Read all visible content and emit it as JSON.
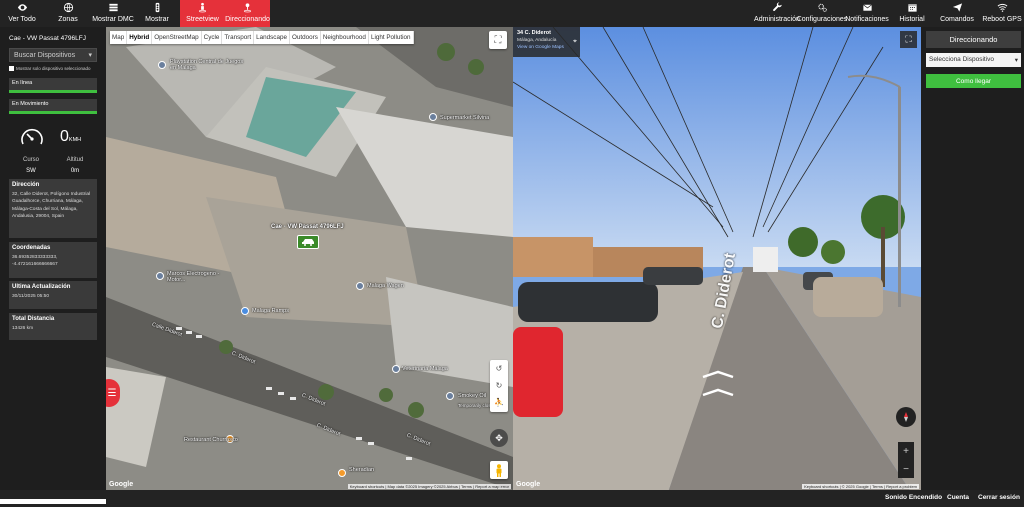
{
  "topbar": {
    "left_items": [
      {
        "label": "Ver Todo",
        "icon": "eye-icon"
      },
      {
        "label": "Zonas",
        "icon": "globe-icon"
      },
      {
        "label": "Mostrar DMC",
        "icon": "server-icon"
      },
      {
        "label": "Mostrar",
        "icon": "traffic-light-icon"
      },
      {
        "label": "Streetview",
        "icon": "streetview-person-icon",
        "active": true
      },
      {
        "label": "Direccionando",
        "icon": "route-icon",
        "active": true
      }
    ],
    "right_items": [
      {
        "label": "Administración",
        "icon": "wrench-icon"
      },
      {
        "label": "Configuraciones",
        "icon": "gears-icon"
      },
      {
        "label": "Notificaciones",
        "icon": "envelope-icon"
      },
      {
        "label": "Historial",
        "icon": "calendar-icon"
      },
      {
        "label": "Comandos",
        "icon": "paper-plane-icon"
      },
      {
        "label": "Reboot GPS",
        "icon": "wifi-icon"
      }
    ],
    "accent_color": "#e5313a"
  },
  "sidebar": {
    "vehicle_title": "Cae - VW Passat 4796LFJ",
    "search_placeholder": "Buscar Dispositivos",
    "only_selected_label": "Mostrar solo dispositivo seleccionado",
    "online_label": "En línea",
    "moving_label": "En Movimiento",
    "speed_value": "0",
    "speed_unit": "KMH",
    "course_label": "Curso",
    "course_value": "SW",
    "altitude_label": "Altitud",
    "altitude_value": "0m",
    "address_title": "Dirección",
    "address_value": "32, Calle Diderot, Polígono Industrial Guadalhorce, Churriana, Málaga, Málaga-Costa del Sol, Málaga, Andalusia, 29004, Spain",
    "coords_title": "Coordenadas",
    "coords_value": "36.69352833333333, -4.472161666666667",
    "last_update_title": "Ultima Actualización",
    "last_update_value": "30/11/2025 05:50",
    "total_distance_title": "Total Distancia",
    "total_distance_value": "13426 km",
    "status_color": "#3fbf3f"
  },
  "map": {
    "tabs": [
      "Map",
      "Hybrid",
      "OpenStreetMap",
      "Cycle",
      "Transport",
      "Landscape",
      "Outdoors",
      "Neighbourhood",
      "Light Pollution"
    ],
    "active_tab": "Hybrid",
    "vehicle_label": "Cae - VW Passat 4796LFJ",
    "poi_labels": [
      "Playstation Central de Juegos en Málaga",
      "Supermarket Silvina",
      "Marcos Electrogeno - Motor...",
      "Malaga Wagen",
      "Malaga Ramps",
      "Calle Diderot",
      "C. Diderot",
      "C. Diderot",
      "C. Diderot",
      "C. Diderot",
      "Veterinaria Málaga",
      "Smokey Oil",
      "Temporarily closed",
      "Restaurant Churrasco",
      "Sheradian"
    ],
    "google_logo": "Google",
    "attribution": "Keyboard shortcuts | Map data ©2025 Imagery ©2025 Airbus | Terms | Report a map error"
  },
  "streetview": {
    "title": "34 C. Diderot",
    "subtitle": "Málaga, Andalucía",
    "link": "View on Google Maps",
    "street_label": "C. Diderot",
    "google_logo": "Google",
    "attribution": "Keyboard shortcuts | © 2025 Google | Terms | Report a problem"
  },
  "rightpanel": {
    "title_button": "Direccionando",
    "select_value": "Selecciona Dispositivo",
    "go_button": "Como llegar"
  },
  "footer": {
    "sound": "Sonido Encendido",
    "account": "Cuenta",
    "logout": "Cerrar sesión"
  }
}
